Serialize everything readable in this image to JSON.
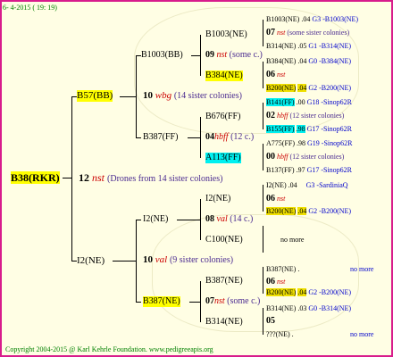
{
  "header": {
    "date": "6- 4-2015 ( 19: 19)"
  },
  "footer": {
    "copyright": "Copyright 2004-2015 @ Karl Kehrle Foundation.   www.pedigreeapis.org"
  },
  "root": {
    "name": "B38(RKR)",
    "gen": "12",
    "gen_mark": "nst",
    "note": "(Drones from 14 sister colonies)"
  },
  "l1": {
    "upper": {
      "name": "B57(BB)",
      "gen": "10",
      "gen_mark": "wbg",
      "note": "(14 sister colonies)"
    },
    "lower": {
      "name": "I2(NE)",
      "gen": "10",
      "gen_mark": "val",
      "note": "(9 sister colonies)"
    }
  },
  "l2": {
    "a": {
      "name": "B1003(BB)",
      "gen": "09",
      "gen_mark": "nst",
      "note": "(some c.)"
    },
    "b": {
      "name": "B387(FF)",
      "gen": "04",
      "gen_mark": "hbff",
      "note": "(12 c.)"
    },
    "c": {
      "name": "I2(NE)",
      "gen": "08",
      "gen_mark": "val",
      "note": "(14 c.)"
    },
    "d": {
      "name": "B387(NE)",
      "gen": "07",
      "gen_mark": "nst",
      "note": "(some c.)"
    }
  },
  "l3": {
    "a": {
      "name": "B1003(NE)"
    },
    "b": {
      "name": "B384(NE)"
    },
    "c": {
      "name": "B676(FF)"
    },
    "d": {
      "name": "A113(FF)"
    },
    "e": {
      "name": "I2(NE)"
    },
    "f": {
      "name": "C100(NE)"
    },
    "g": {
      "name": "B387(NE)"
    },
    "h": {
      "name": "B314(NE)"
    }
  },
  "l4": [
    {
      "name": "B1003(NE)",
      "val": ".04",
      "code": "G3 -B1003(NE)"
    },
    {
      "gen": "07",
      "mark": "nst",
      "note": "(some sister colonies)"
    },
    {
      "name": "B314(NE)",
      "val": ".05",
      "code": "G1 -B314(NE)"
    },
    {
      "name": "B384(NE)",
      "val": ".04",
      "code": "G0 -B384(NE)"
    },
    {
      "gen": "06",
      "mark": "nst",
      "note": ""
    },
    {
      "name": "B200(NE)",
      "val": ".04",
      "code": "G2 -B200(NE)"
    },
    {
      "name": "B141(FF)",
      "val": ".00",
      "code": "G18 -Sinop62R"
    },
    {
      "gen": "02",
      "mark": "hbff",
      "note": "(12 sister colonies)"
    },
    {
      "name": "B155(FF)",
      "val": ".98",
      "code": "G17 -Sinop62R"
    },
    {
      "name": "A775(FF)",
      "val": ".98",
      "code": "G19 -Sinop62R"
    },
    {
      "gen": "00",
      "mark": "hbff",
      "note": "(12 sister colonies)"
    },
    {
      "name": "B137(FF)",
      "val": ".97",
      "code": "G17 -Sinop62R"
    },
    {
      "name": "I2(NE)",
      "val": ".04",
      "code": "G3 -SardiniaQ"
    },
    {
      "gen": "06",
      "mark": "nst",
      "note": ""
    },
    {
      "name": "B200(NE)",
      "val": ".04",
      "code": "G2 -B200(NE)"
    },
    {
      "note_only": "no more"
    },
    {
      "name": "B387(NE)",
      "val": ".",
      "code": "no more"
    },
    {
      "gen": "06",
      "mark": "nst",
      "note": ""
    },
    {
      "name": "B200(NE)",
      "val": ".04",
      "code": "G2 -B200(NE)"
    },
    {
      "name": "B314(NE)",
      "val": ".03",
      "code": "G0 -B314(NE)"
    },
    {
      "gen": "05",
      "mark": "",
      "note": ""
    },
    {
      "name": "???(NE)",
      "val": ".",
      "code": "no more"
    }
  ]
}
